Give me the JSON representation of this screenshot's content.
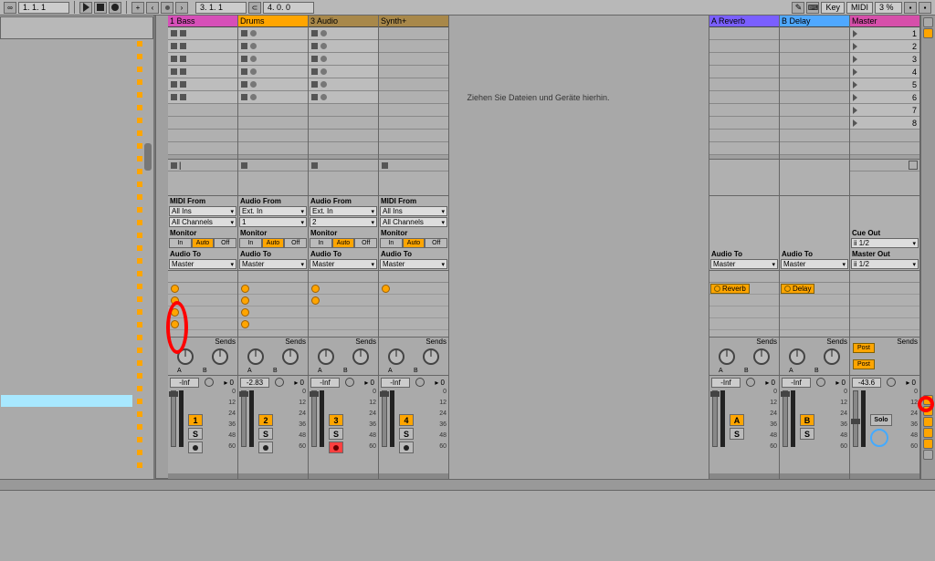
{
  "topbar": {
    "pos1": "1. 1. 1",
    "pos2": "3. 1. 1",
    "pos3": "4. 0. 0",
    "key_label": "Key",
    "midi_label": "MIDI",
    "cpu": "3 %"
  },
  "drop_text": "Ziehen Sie Dateien und Geräte hierhin.",
  "db_marks": [
    "0",
    "12",
    "24",
    "36",
    "48",
    "60"
  ],
  "tracks": [
    {
      "title": "1 Bass",
      "color": "#d64fb8",
      "clips": 6,
      "clip_shape": "sq",
      "io_title": "MIDI From",
      "in1": "All Ins",
      "in2": "All Channels",
      "mon": "Auto",
      "out_lbl": "Audio To",
      "out": "Master",
      "sends": 4,
      "vol": "-Inf",
      "num": "1",
      "solo": "S",
      "rec": true,
      "pan": "0"
    },
    {
      "title": "Drums",
      "color": "#ffa500",
      "clips": 6,
      "clip_shape": "cir",
      "io_title": "Audio From",
      "in1": "Ext. In",
      "in2": "1",
      "mon": "Auto",
      "out_lbl": "Audio To",
      "out": "Master",
      "sends": 4,
      "vol": "-2.83",
      "num": "2",
      "solo": "S",
      "rec": true,
      "pan": "0"
    },
    {
      "title": "3 Audio",
      "color": "#a8884a",
      "clips": 6,
      "clip_shape": "cir",
      "io_title": "Audio From",
      "in1": "Ext. In",
      "in2": "2",
      "mon": "Auto",
      "out_lbl": "Audio To",
      "out": "Master",
      "sends": 2,
      "vol": "-Inf",
      "num": "3",
      "solo": "S",
      "rec": true,
      "rec_on": true,
      "pan": "0"
    },
    {
      "title": "Synth+",
      "color": "#a8884a",
      "clips": 0,
      "io_title": "MIDI From",
      "in1": "All Ins",
      "in2": "All Channels",
      "mon": "Auto",
      "out_lbl": "Audio To",
      "out": "Master",
      "sends": 1,
      "vol": "-Inf",
      "num": "4",
      "solo": "S",
      "rec": true,
      "pan": "0"
    }
  ],
  "returns": [
    {
      "title": "A Reverb",
      "color": "#7a5fff",
      "out_lbl": "Audio To",
      "out": "Master",
      "rlabel": "Reverb",
      "vol": "-Inf",
      "num": "A",
      "solo": "S",
      "pan": "0"
    },
    {
      "title": "B Delay",
      "color": "#4fa8ff",
      "out_lbl": "Audio To",
      "out": "Master",
      "rlabel": "Delay",
      "vol": "-Inf",
      "num": "B",
      "solo": "S",
      "pan": "0"
    }
  ],
  "master": {
    "title": "Master",
    "color": "#d64faa",
    "cue_lbl": "Cue Out",
    "cue": "ii 1/2",
    "mout_lbl": "Master Out",
    "mout": "ii 1/2",
    "post": "Post",
    "vol": "-43.6",
    "solo": "Solo",
    "sends_lbl": "Sends",
    "pan": "0"
  },
  "scenes": [
    "1",
    "2",
    "3",
    "4",
    "5",
    "6",
    "7",
    "8"
  ],
  "labels": {
    "sends": "Sends",
    "monitor": "Monitor",
    "in": "In",
    "auto": "Auto",
    "off": "Off"
  }
}
